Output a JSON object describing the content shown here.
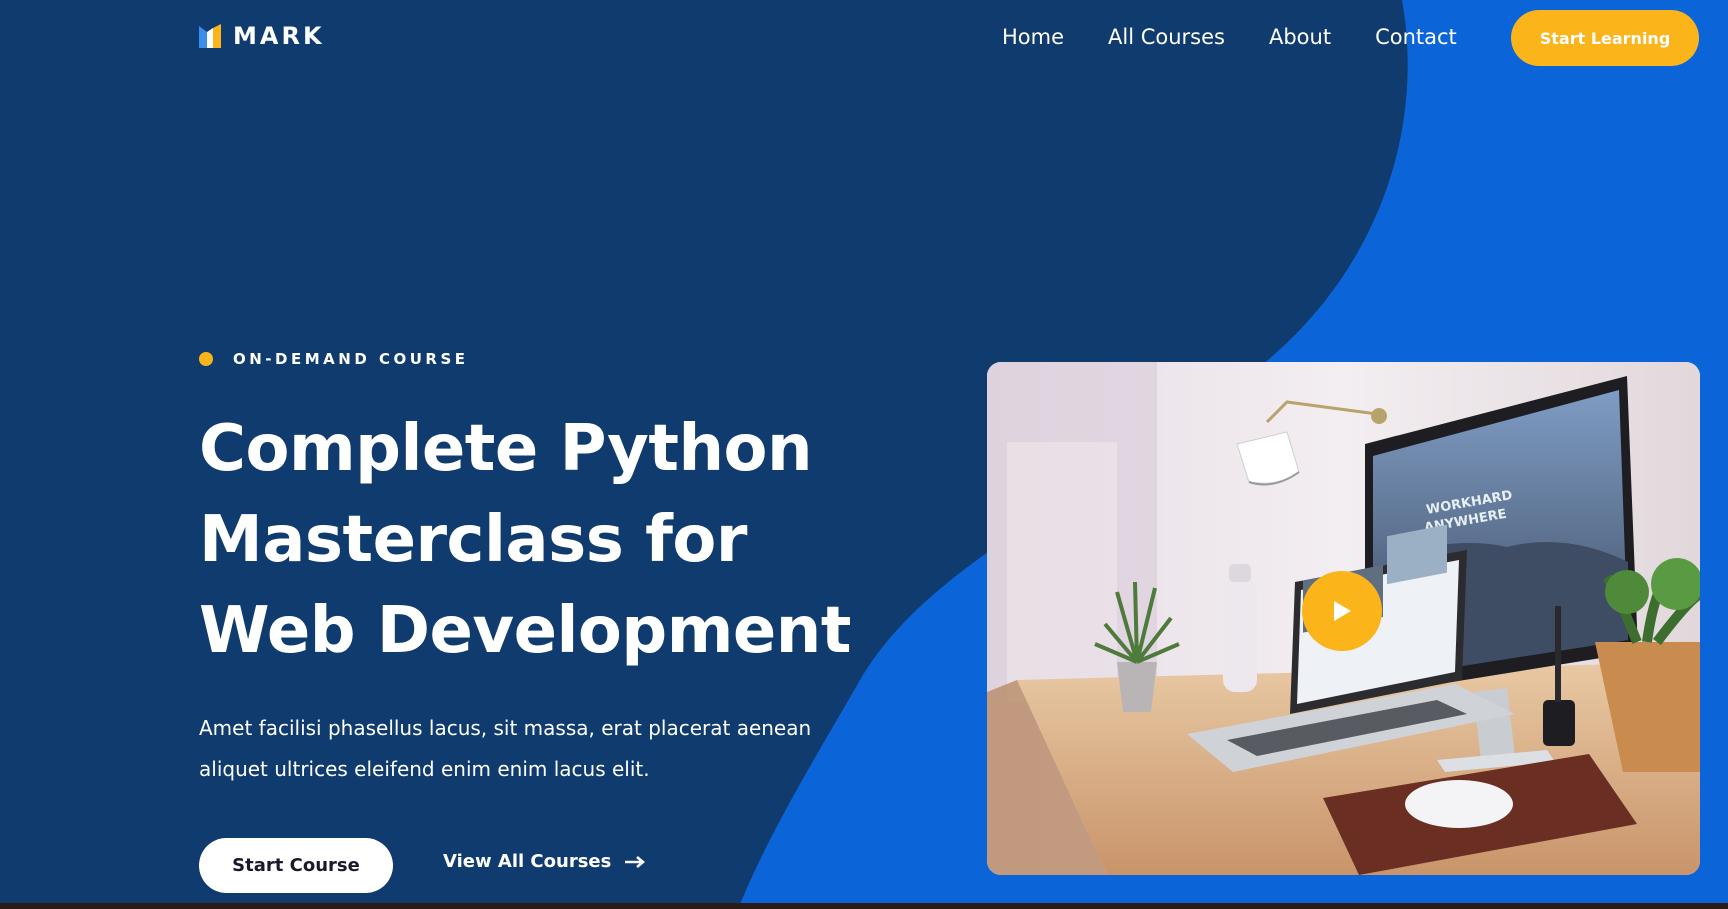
{
  "brand": {
    "name": "MARK"
  },
  "nav": {
    "links": [
      "Home",
      "All Courses",
      "About",
      "Contact"
    ],
    "cta_label": "Start Learning"
  },
  "hero": {
    "eyebrow": "ON-DEMAND COURSE",
    "title_lines": [
      "Complete Python",
      "Masterclass for",
      "Web Development"
    ],
    "description_lines": [
      "Amet facilisi phasellus lacus, sit massa, erat placerat aenean",
      "aliquet ultrices eleifend enim enim lacus elit."
    ],
    "primary_button": "Start Course",
    "secondary_link": "View All Courses"
  },
  "video": {
    "screen_text_line1": "WORKHARD",
    "screen_text_line2": "ANYWHERE"
  },
  "colors": {
    "background_dark": "#0f3b6e",
    "background_blue": "#0b65d8",
    "accent": "#fbb41a",
    "text": "#ffffff"
  },
  "icons": [
    "logo-icon",
    "arrow-right-icon",
    "play-icon"
  ]
}
